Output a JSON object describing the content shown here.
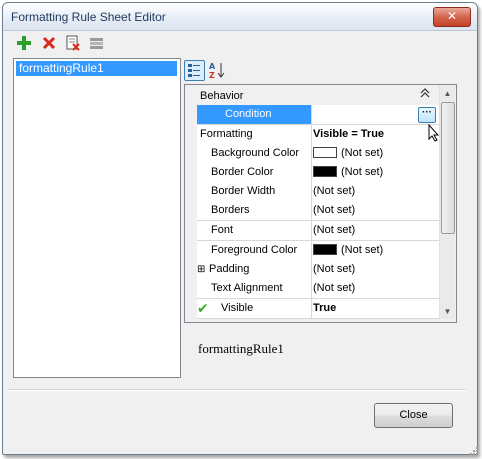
{
  "window": {
    "title": "Formatting Rule Sheet Editor",
    "close_glyph": "✕"
  },
  "toolbar": {
    "items": [
      {
        "icon": "plus-icon",
        "color": "#2a9d2a"
      },
      {
        "icon": "delete-icon",
        "color": "#d8271b"
      },
      {
        "icon": "delete-document-icon"
      },
      {
        "icon": "clear-icon"
      }
    ]
  },
  "rules_list": {
    "items": [
      "formattingRule1"
    ]
  },
  "property_grid": {
    "toolbar": {
      "categorized_icon": "categorized-icon",
      "alphabetical_icon": "sort-az-icon"
    },
    "category": {
      "label": "Behavior",
      "toggle": "⌃"
    },
    "rows": [
      {
        "name": "Condition",
        "value": "",
        "selected": true,
        "has_ellipsis": true,
        "ellipsis": "···"
      },
      {
        "name": "Formatting",
        "value": "Visible = True",
        "bold_value": true,
        "expander": "⊟"
      },
      {
        "name": "Background Color",
        "value": "(Not set)",
        "swatch": "#ffffff"
      },
      {
        "name": "Border Color",
        "value": "(Not set)",
        "swatch": "#000000"
      },
      {
        "name": "Border Width",
        "value": "(Not set)"
      },
      {
        "name": "Borders",
        "value": "(Not set)"
      },
      {
        "name": "Font",
        "value": "(Not set)"
      },
      {
        "name": "Foreground Color",
        "value": "(Not set)",
        "swatch": "#000000"
      },
      {
        "name": "Padding",
        "value": "(Not set)",
        "expander": "⊞"
      },
      {
        "name": "Text Alignment",
        "value": "(Not set)"
      },
      {
        "name": "Visible",
        "value": "True",
        "bold_value": true,
        "check": "✔"
      }
    ]
  },
  "preview": {
    "text": "formattingRule1"
  },
  "footer": {
    "close_label": "Close"
  },
  "colors": {
    "selection": "#3399ff",
    "check": "#3cae2d"
  }
}
